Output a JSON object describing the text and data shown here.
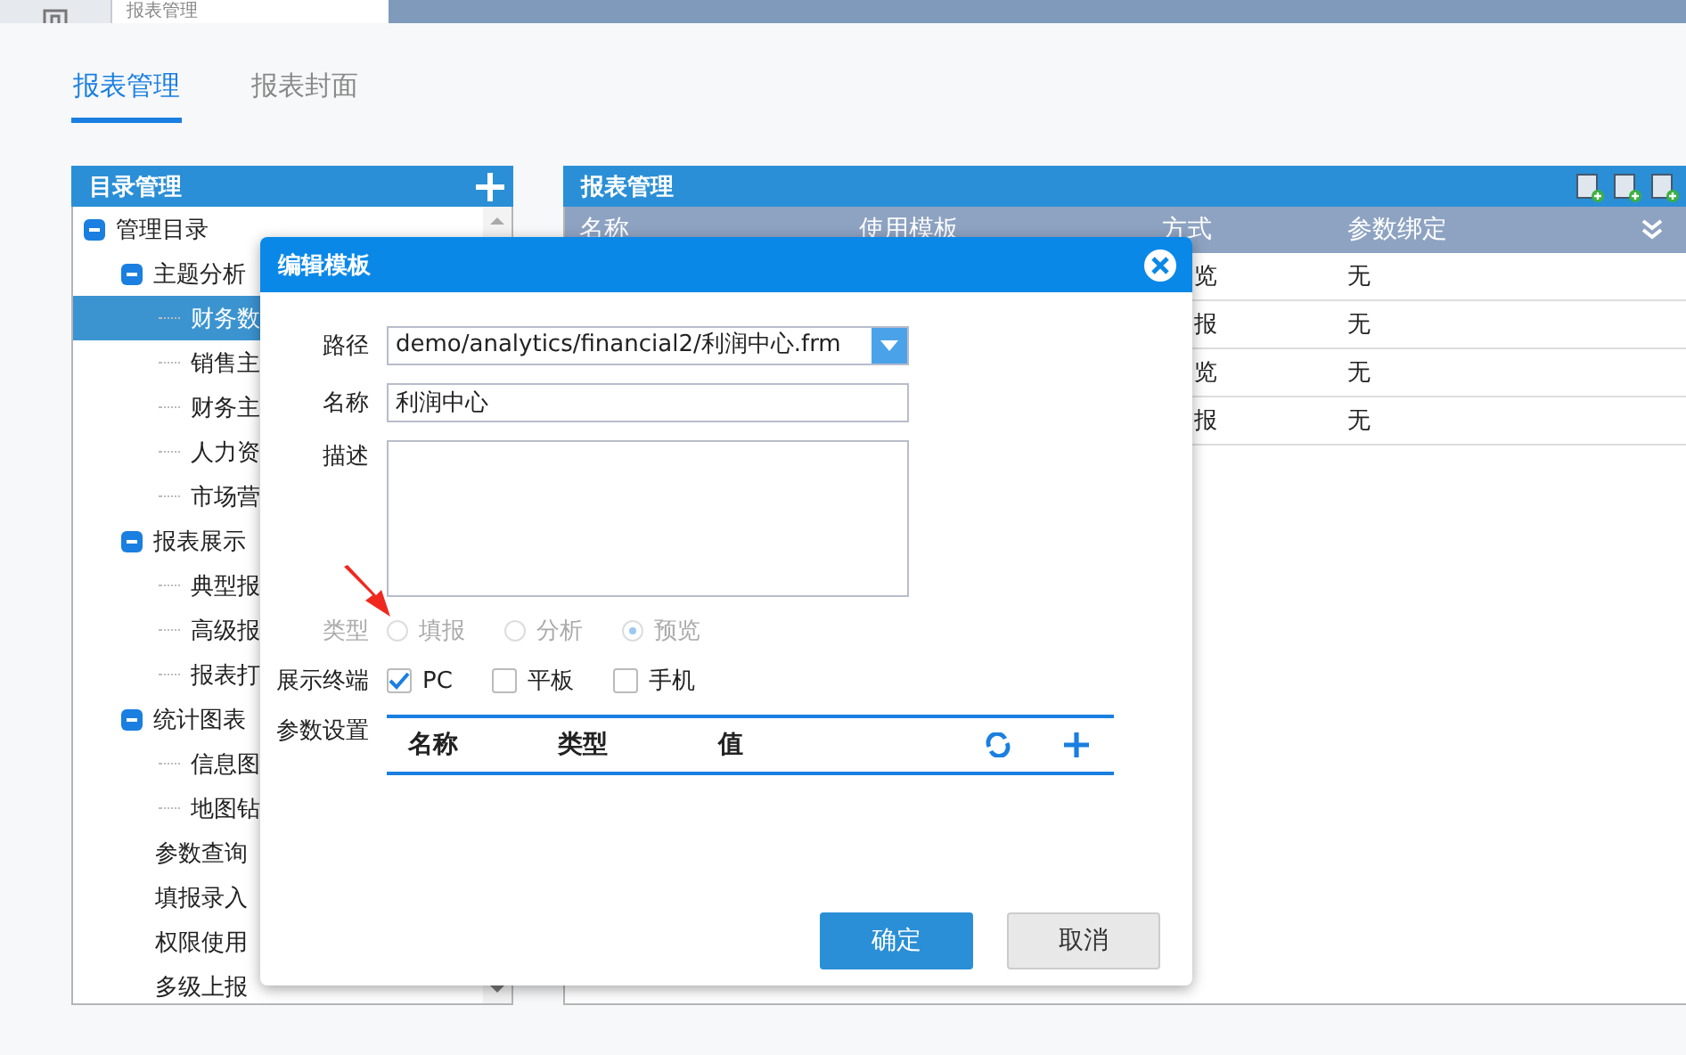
{
  "top_bar": {
    "home": {
      "selected": false
    },
    "tabs": [
      {
        "label": "报表管理",
        "selected": true
      }
    ]
  },
  "page_tabs": [
    {
      "label": "报表管理",
      "selected": true
    },
    {
      "label": "报表封面",
      "selected": false
    }
  ],
  "catalog": {
    "title": "目录管理",
    "tree": [
      {
        "label": "管理目录",
        "selected": false,
        "expanded": true,
        "children": [
          {
            "label": "主题分析",
            "selected": false,
            "expanded": true,
            "children": [
              {
                "label": "财务数",
                "selected": true
              },
              {
                "label": "销售主",
                "selected": false
              },
              {
                "label": "财务主",
                "selected": false
              },
              {
                "label": "人力资",
                "selected": false
              },
              {
                "label": "市场营",
                "selected": false
              }
            ]
          },
          {
            "label": "报表展示",
            "selected": false,
            "expanded": true,
            "children": [
              {
                "label": "典型报",
                "selected": false
              },
              {
                "label": "高级报",
                "selected": false
              },
              {
                "label": "报表打",
                "selected": false
              }
            ]
          },
          {
            "label": "统计图表",
            "selected": false,
            "expanded": true,
            "children": [
              {
                "label": "信息图",
                "selected": false
              },
              {
                "label": "地图钻",
                "selected": false
              }
            ]
          },
          {
            "label": "参数查询",
            "selected": false
          },
          {
            "label": "填报录入",
            "selected": false
          },
          {
            "label": "权限使用",
            "selected": false
          },
          {
            "label": "多级上报",
            "selected": false
          }
        ]
      }
    ]
  },
  "reports": {
    "title": "报表管理",
    "columns": [
      "名称",
      "使用模板",
      "方式",
      "参数绑定"
    ],
    "rows": [
      {
        "column_3": "览",
        "param_binding": "无"
      },
      {
        "column_3": "报",
        "param_binding": "无"
      },
      {
        "column_3": "览",
        "param_binding": "无"
      },
      {
        "column_3": "报",
        "param_binding": "无"
      }
    ]
  },
  "dialog": {
    "title": "编辑模板",
    "path": {
      "label": "路径",
      "value": "demo/analytics/financial2/利润中心.frm"
    },
    "name": {
      "label": "名称",
      "value": "利润中心"
    },
    "description": {
      "label": "描述"
    },
    "type": {
      "label": "类型",
      "disabled": true,
      "options": [
        {
          "label": "填报",
          "selected": false
        },
        {
          "label": "分析",
          "selected": false
        },
        {
          "label": "预览",
          "selected": true
        }
      ]
    },
    "terminals": {
      "label": "展示终端",
      "options": [
        {
          "label": "PC",
          "checked": true
        },
        {
          "label": "平板",
          "checked": false
        },
        {
          "label": "手机",
          "checked": false
        }
      ]
    },
    "parameters": {
      "label": "参数设置",
      "columns": [
        "名称",
        "类型",
        "值"
      ]
    },
    "buttons": [
      {
        "label": "确定",
        "kind": "primary"
      },
      {
        "label": "取消",
        "kind": "secondary"
      }
    ]
  }
}
